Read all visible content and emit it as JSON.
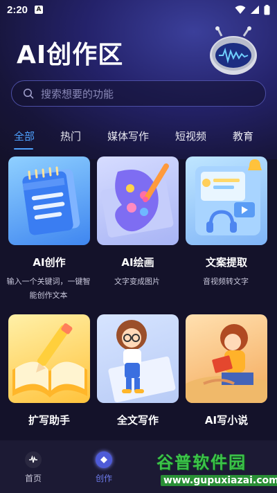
{
  "status": {
    "time": "2:20",
    "notif_letter": "A"
  },
  "title": "AI创作区",
  "search": {
    "placeholder": "搜索想要的功能"
  },
  "tabs": [
    {
      "label": "全部",
      "active": true
    },
    {
      "label": "热门",
      "active": false
    },
    {
      "label": "媒体写作",
      "active": false
    },
    {
      "label": "短视频",
      "active": false
    },
    {
      "label": "教育",
      "active": false
    }
  ],
  "cards": [
    {
      "title": "AI创作",
      "desc": "输入一个关键词，一键智能创作文本",
      "icon": "notepad-icon"
    },
    {
      "title": "AI绘画",
      "desc": "文字变成图片",
      "icon": "palette-icon"
    },
    {
      "title": "文案提取",
      "desc": "音视频转文字",
      "icon": "phone-audio-icon"
    },
    {
      "title": "扩写助手",
      "desc": "",
      "icon": "book-pencil-icon"
    },
    {
      "title": "全文写作",
      "desc": "",
      "icon": "girl-writing-icon"
    },
    {
      "title": "AI写小说",
      "desc": "",
      "icon": "girl-reading-icon"
    }
  ],
  "nav": [
    {
      "label": "首页",
      "active": false
    },
    {
      "label": "创作",
      "active": true
    }
  ],
  "watermark": {
    "title": "谷普软件园",
    "url": "www.gupuxiazai.com"
  },
  "colors": {
    "accent": "#4ea2ff",
    "background": "#14122a",
    "nav_active": "#4e5bd8"
  }
}
